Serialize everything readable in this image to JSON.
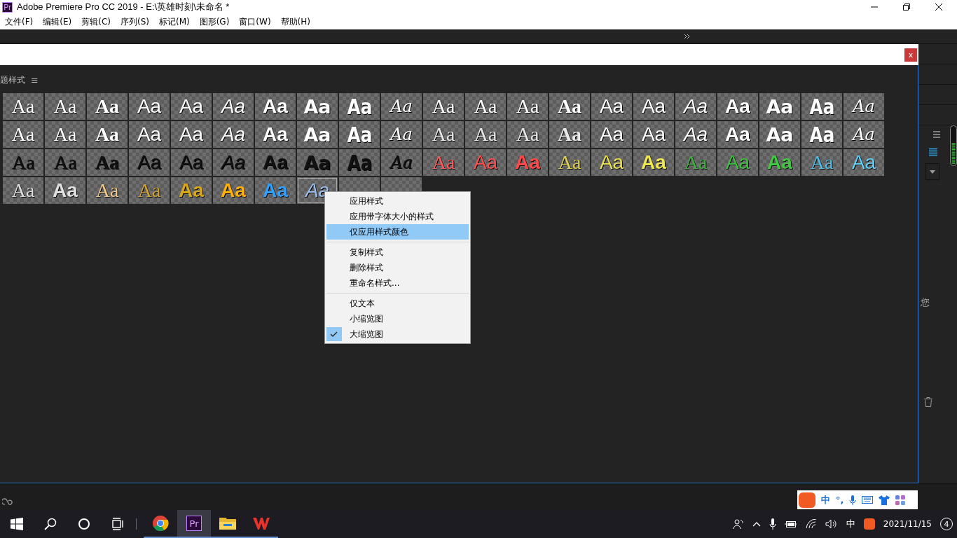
{
  "window": {
    "icon_text": "Pr",
    "title": "Adobe Premiere Pro CC 2019 - E:\\英雄时刻\\未命名 *"
  },
  "menu_bar": [
    "文件(F)",
    "编辑(E)",
    "剪辑(C)",
    "序列(S)",
    "标记(M)",
    "图形(G)",
    "窗口(W)",
    "帮助(H)"
  ],
  "dialog": {
    "close_label": "x",
    "panel_title": "题样式",
    "panel_menu": "≡",
    "style_rows": [
      [
        {
          "text": "Aa",
          "kind": "serif",
          "color": "#ffffff",
          "selected": false
        },
        {
          "text": "Aa",
          "kind": "serif",
          "color": "#ffffff",
          "selected": false
        },
        {
          "text": "Aa",
          "kind": "outline",
          "color": "#ffffff",
          "selected": false
        },
        {
          "text": "Aa",
          "kind": "sans",
          "color": "#ffffff",
          "selected": false
        },
        {
          "text": "Aa",
          "kind": "sans",
          "color": "#ffffff",
          "selected": false
        },
        {
          "text": "Aa",
          "kind": "italic",
          "color": "#ffffff",
          "selected": false
        },
        {
          "text": "Aa",
          "kind": "bold",
          "color": "#ffffff",
          "selected": false
        },
        {
          "text": "Aa",
          "kind": "heavy",
          "color": "#ffffff",
          "selected": false
        },
        {
          "text": "Aa",
          "kind": "condensed",
          "color": "#ffffff",
          "selected": false
        },
        {
          "text": "Aa",
          "kind": "script",
          "color": "#ffffff",
          "selected": false
        },
        {
          "text": "Aa",
          "kind": "serif",
          "color": "#ffffff",
          "selected": false
        },
        {
          "text": "Aa",
          "kind": "serif",
          "color": "#ffffff",
          "selected": false
        },
        {
          "text": "Aa",
          "kind": "serif",
          "color": "#ffffff",
          "selected": false
        },
        {
          "text": "Aa",
          "kind": "outline",
          "color": "#ffffff",
          "selected": false
        },
        {
          "text": "Aa",
          "kind": "sans",
          "color": "#ffffff",
          "selected": false
        },
        {
          "text": "Aa",
          "kind": "sans",
          "color": "#ffffff",
          "selected": false
        },
        {
          "text": "Aa",
          "kind": "italic",
          "color": "#ffffff",
          "selected": false
        },
        {
          "text": "Aa",
          "kind": "bold",
          "color": "#ffffff",
          "selected": false
        },
        {
          "text": "Aa",
          "kind": "heavy",
          "color": "#ffffff",
          "selected": false
        },
        {
          "text": "Aa",
          "kind": "condensed",
          "color": "#ffffff",
          "selected": false
        },
        {
          "text": "Aa",
          "kind": "script",
          "color": "#ffffff",
          "selected": false
        }
      ],
      [
        {
          "text": "Aa",
          "kind": "serif",
          "color": "#ffffff",
          "selected": false
        },
        {
          "text": "Aa",
          "kind": "serif",
          "color": "#ffffff",
          "selected": false
        },
        {
          "text": "Aa",
          "kind": "outline",
          "color": "#ffffff",
          "selected": false
        },
        {
          "text": "Aa",
          "kind": "sans",
          "color": "#ffffff",
          "selected": false
        },
        {
          "text": "Aa",
          "kind": "sans",
          "color": "#ffffff",
          "selected": false
        },
        {
          "text": "Aa",
          "kind": "italic",
          "color": "#ffffff",
          "selected": false
        },
        {
          "text": "Aa",
          "kind": "bold",
          "color": "#ffffff",
          "selected": false
        },
        {
          "text": "Aa",
          "kind": "heavy",
          "color": "#ffffff",
          "selected": false
        },
        {
          "text": "Aa",
          "kind": "condensed",
          "color": "#ffffff",
          "selected": false
        },
        {
          "text": "Aa",
          "kind": "script",
          "color": "#ffffff",
          "selected": false
        },
        {
          "text": "Aa",
          "kind": "serif",
          "color": "#e8e8e8",
          "selected": false
        },
        {
          "text": "Aa",
          "kind": "serif",
          "color": "#e8e8e8",
          "selected": false
        },
        {
          "text": "Aa",
          "kind": "serif",
          "color": "#e8e8e8",
          "selected": false
        },
        {
          "text": "Aa",
          "kind": "outline",
          "color": "#e8e8e8",
          "selected": false
        },
        {
          "text": "Aa",
          "kind": "sans",
          "color": "#ffffff",
          "selected": false
        },
        {
          "text": "Aa",
          "kind": "sans",
          "color": "#ffffff",
          "selected": false
        },
        {
          "text": "Aa",
          "kind": "italic",
          "color": "#ffffff",
          "selected": false
        },
        {
          "text": "Aa",
          "kind": "bold",
          "color": "#ffffff",
          "selected": false
        },
        {
          "text": "Aa",
          "kind": "heavy",
          "color": "#ffffff",
          "selected": false
        },
        {
          "text": "Aa",
          "kind": "condensed",
          "color": "#ffffff",
          "selected": false
        },
        {
          "text": "Aa",
          "kind": "script",
          "color": "#ffffff",
          "selected": false
        }
      ],
      [
        {
          "text": "Aa",
          "kind": "serif",
          "color": "#111111",
          "selected": false
        },
        {
          "text": "Aa",
          "kind": "serif",
          "color": "#111111",
          "selected": false
        },
        {
          "text": "Aa",
          "kind": "outline",
          "color": "#111111",
          "selected": false
        },
        {
          "text": "Aa",
          "kind": "sans",
          "color": "#111111",
          "selected": false
        },
        {
          "text": "Aa",
          "kind": "sans",
          "color": "#111111",
          "selected": false
        },
        {
          "text": "Aa",
          "kind": "italic",
          "color": "#111111",
          "selected": false
        },
        {
          "text": "Aa",
          "kind": "bold",
          "color": "#111111",
          "selected": false
        },
        {
          "text": "Aa",
          "kind": "heavy",
          "color": "#111111",
          "selected": false
        },
        {
          "text": "Aa",
          "kind": "condensed",
          "color": "#111111",
          "selected": false
        },
        {
          "text": "Aa",
          "kind": "script",
          "color": "#111111",
          "selected": false
        },
        {
          "text": "Aa",
          "kind": "serif",
          "color": "#ff5a5a",
          "selected": false
        },
        {
          "text": "Aa",
          "kind": "sans",
          "color": "#ff5050",
          "selected": false
        },
        {
          "text": "Aa",
          "kind": "bold",
          "color": "#ff4848",
          "selected": false
        },
        {
          "text": "Aa",
          "kind": "serif",
          "color": "#e0d050",
          "selected": false
        },
        {
          "text": "Aa",
          "kind": "sans",
          "color": "#e8e050",
          "selected": false
        },
        {
          "text": "Aa",
          "kind": "bold",
          "color": "#f0e850",
          "selected": false
        },
        {
          "text": "Aa",
          "kind": "serif",
          "color": "#40b040",
          "selected": false
        },
        {
          "text": "Aa",
          "kind": "sans",
          "color": "#40c040",
          "selected": false
        },
        {
          "text": "Aa",
          "kind": "bold",
          "color": "#40c840",
          "selected": false
        },
        {
          "text": "Aa",
          "kind": "serif",
          "color": "#50c0e8",
          "selected": false
        },
        {
          "text": "Aa",
          "kind": "sans",
          "color": "#60d0f8",
          "selected": false
        }
      ],
      [
        {
          "text": "Aa",
          "kind": "serif",
          "color": "#dddddd",
          "selected": false
        },
        {
          "text": "Aa",
          "kind": "bold",
          "color": "#e0e0e0",
          "selected": false
        },
        {
          "text": "Aa",
          "kind": "serif",
          "color": "#f0c888",
          "selected": false
        },
        {
          "text": "Aa",
          "kind": "serif",
          "color": "#d0a030",
          "selected": false
        },
        {
          "text": "Aa",
          "kind": "bold",
          "color": "#d8a818",
          "selected": false
        },
        {
          "text": "Aa",
          "kind": "bold",
          "color": "#ffb000",
          "selected": false
        },
        {
          "text": "Aa",
          "kind": "bold",
          "color": "#30a0ff",
          "selected": false
        },
        {
          "text": "Aa",
          "kind": "italic",
          "color": "#98bff0",
          "selected": true
        },
        {
          "selected": false
        },
        {
          "selected": false
        }
      ]
    ],
    "context_menu": [
      [
        {
          "label": "应用样式",
          "selected": false,
          "checked": false
        },
        {
          "label": "应用带字体大小的样式",
          "selected": false,
          "checked": false
        },
        {
          "label": "仅应用样式颜色",
          "selected": true,
          "checked": false
        }
      ],
      [
        {
          "label": "复制样式",
          "selected": false,
          "checked": false
        },
        {
          "label": "删除样式",
          "selected": false,
          "checked": false
        },
        {
          "label": "重命名样式...",
          "selected": false,
          "checked": false
        }
      ],
      [
        {
          "label": "仅文本",
          "selected": false,
          "checked": false
        },
        {
          "label": "小缩览图",
          "selected": false,
          "checked": false
        },
        {
          "label": "大缩览图",
          "selected": false,
          "checked": true
        }
      ]
    ]
  },
  "right_panel": {
    "text": "您"
  },
  "ime_bar": {
    "mode": "中",
    "punct": "°,"
  },
  "taskbar": {
    "apps": [
      {
        "kind": "chrome",
        "selected": false
      },
      {
        "kind": "premiere",
        "label": "Pr",
        "selected": true
      },
      {
        "kind": "explorer",
        "selected": false
      },
      {
        "kind": "wps",
        "selected": false
      }
    ],
    "tray_lang": "中",
    "date": "2021/11/15",
    "notifications": "4"
  }
}
